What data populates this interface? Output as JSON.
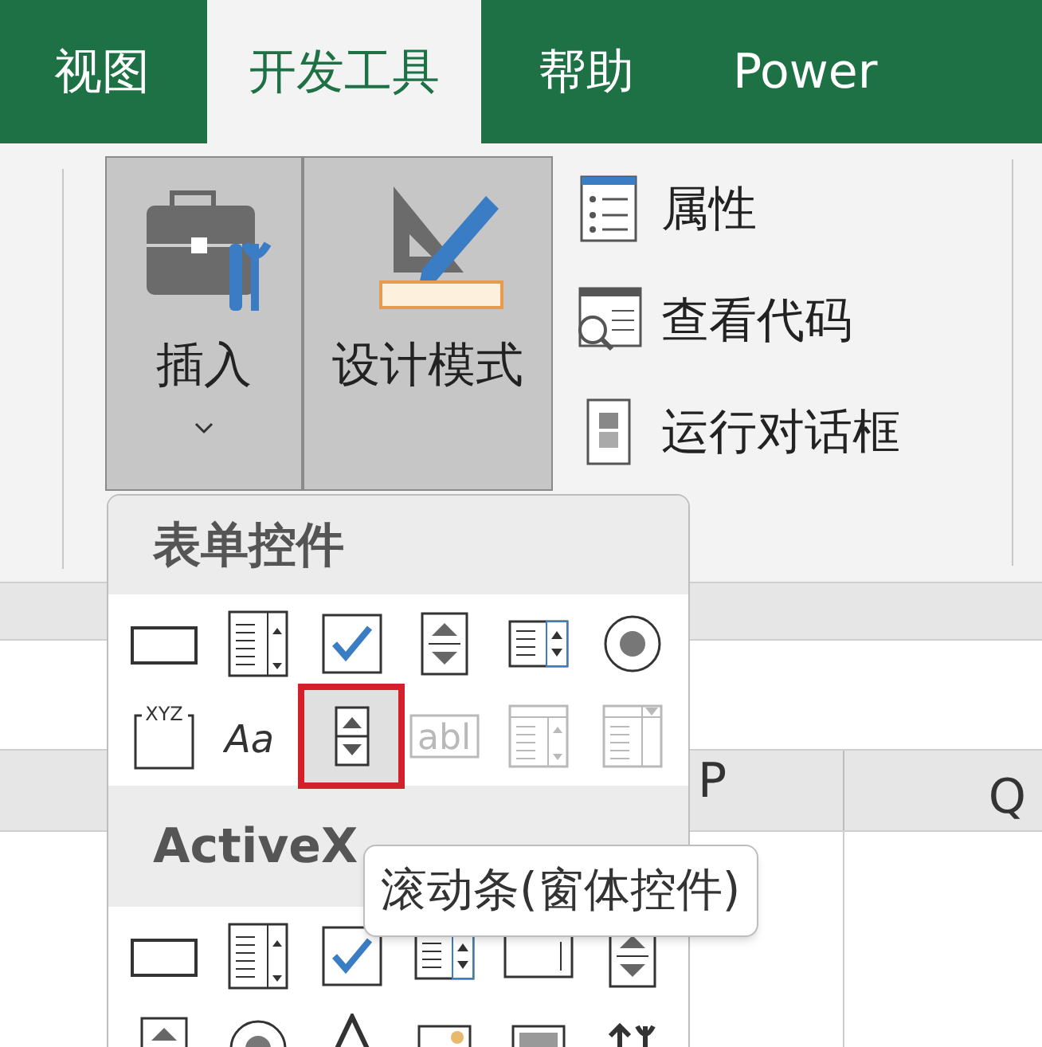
{
  "tabs": [
    {
      "label": "视图",
      "selected": false
    },
    {
      "label": "开发工具",
      "selected": true
    },
    {
      "label": "帮助",
      "selected": false
    },
    {
      "label": "Power",
      "selected": false
    }
  ],
  "ribbon": {
    "large_buttons": [
      {
        "label": "插入",
        "kind": "insert",
        "dropdown": true,
        "pressed": true
      },
      {
        "label": "设计模式",
        "kind": "design",
        "dropdown": false,
        "pressed": true
      }
    ],
    "small_buttons": [
      {
        "label": "属性",
        "kind": "properties"
      },
      {
        "label": "查看代码",
        "kind": "code"
      },
      {
        "label": "运行对话框",
        "kind": "dialog"
      }
    ]
  },
  "sheet": {
    "columns": [
      {
        "label": "P"
      },
      {
        "label": "Q"
      }
    ]
  },
  "menu": {
    "sections": [
      {
        "title": "表单控件",
        "items": [
          {
            "kind": "button",
            "selected": false,
            "disabled": false
          },
          {
            "kind": "combo",
            "selected": false,
            "disabled": false
          },
          {
            "kind": "checkbox",
            "selected": false,
            "disabled": false
          },
          {
            "kind": "spin",
            "selected": false,
            "disabled": false
          },
          {
            "kind": "listbox",
            "selected": false,
            "disabled": false
          },
          {
            "kind": "option",
            "selected": false,
            "disabled": false
          },
          {
            "kind": "group",
            "text": "XYZ",
            "selected": false,
            "disabled": false
          },
          {
            "kind": "label",
            "text": "Aa",
            "selected": false,
            "disabled": false
          },
          {
            "kind": "scrollbar",
            "selected": true,
            "disabled": false
          },
          {
            "kind": "textfield",
            "text": "abl",
            "selected": false,
            "disabled": true
          },
          {
            "kind": "listedit",
            "selected": false,
            "disabled": true
          },
          {
            "kind": "dropedit",
            "selected": false,
            "disabled": true
          }
        ]
      },
      {
        "title": "ActiveX",
        "items": [
          {
            "kind": "button",
            "selected": false
          },
          {
            "kind": "combo",
            "selected": false
          },
          {
            "kind": "checkbox",
            "selected": false
          },
          {
            "kind": "listbox",
            "selected": false
          },
          {
            "kind": "textfield",
            "selected": false
          },
          {
            "kind": "spin",
            "selected": false
          },
          {
            "kind": "spin",
            "selected": false
          },
          {
            "kind": "option",
            "selected": false
          },
          {
            "kind": "label",
            "selected": false
          },
          {
            "kind": "image",
            "selected": false
          },
          {
            "kind": "toggle",
            "selected": false
          },
          {
            "kind": "tools",
            "selected": false
          }
        ]
      }
    ]
  },
  "tooltip": {
    "text": "滚动条(窗体控件)"
  }
}
